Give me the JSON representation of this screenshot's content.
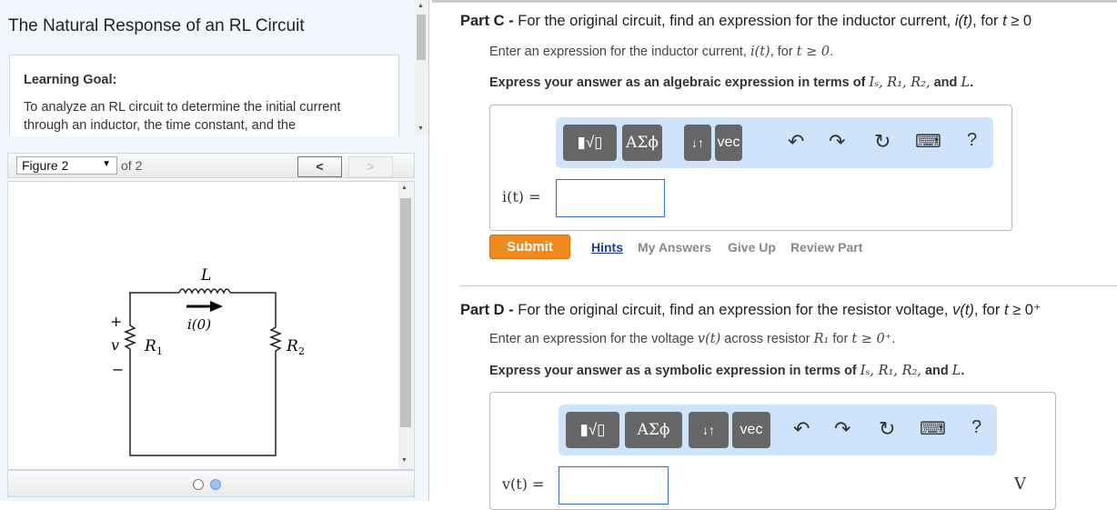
{
  "left": {
    "title": "The Natural Response of an RL Circuit",
    "goal_heading": "Learning Goal:",
    "goal_text": "To analyze an RL circuit to determine the initial current through an inductor, the time constant, and the",
    "figure_select": "Figure 2",
    "figure_of": "of 2",
    "prev": "<",
    "next": ">",
    "circuit": {
      "L": "L",
      "i0": "i(0)",
      "v": "v",
      "plus": "+",
      "minus": "−",
      "R1": "R",
      "R1_sub": "1",
      "R2": "R",
      "R2_sub": "2"
    }
  },
  "partC": {
    "label": "Part C",
    "sep": " - ",
    "question": "For the original circuit, find an expression for the inductor current, ",
    "q_var": "i(t)",
    "q_mid": ", for ",
    "q_cond": "t",
    "q_end": " ≥ 0",
    "enter": "Enter an expression for the inductor current, ",
    "enter_math": "i(t)",
    "enter_mid": ", for ",
    "enter_cond": "t ≥ 0",
    "enter_end": ".",
    "express": "Express your answer as an algebraic expression in terms of ",
    "express_vars": "Iₛ, R₁, R₂,",
    "express_and": " and ",
    "express_last": "L",
    "express_end": ".",
    "input_label": "i(t) =",
    "input_value": "",
    "submit": "Submit",
    "links": [
      "Hints",
      "My Answers",
      "Give Up",
      "Review Part"
    ]
  },
  "partD": {
    "label": "Part D",
    "sep": " - ",
    "question": "For the original circuit, find an expression for the resistor voltage, ",
    "q_var": "v(t)",
    "q_mid": ", for ",
    "q_cond": "t",
    "q_end": " ≥ 0⁺",
    "enter": "Enter an expression for the voltage ",
    "enter_math": "v(t)",
    "enter_mid": " across resistor ",
    "enter_r": "R₁",
    "enter_for": " for ",
    "enter_cond": "t ≥ 0⁺",
    "enter_end": ".",
    "express": "Express your answer as a symbolic expression in terms of ",
    "express_vars": "Iₛ, R₁, R₂,",
    "express_and": " and ",
    "express_last": "L",
    "express_end": ".",
    "input_label": "v(t) =",
    "input_value": "",
    "unit": "V"
  },
  "toolbar": {
    "templates": "▮√▯",
    "greek": "ΑΣϕ",
    "arrows": "↓↑",
    "vec": "vec",
    "undo": "↶",
    "redo": "↷",
    "reset": "↻",
    "keyboard": "⌨",
    "help": "?"
  }
}
